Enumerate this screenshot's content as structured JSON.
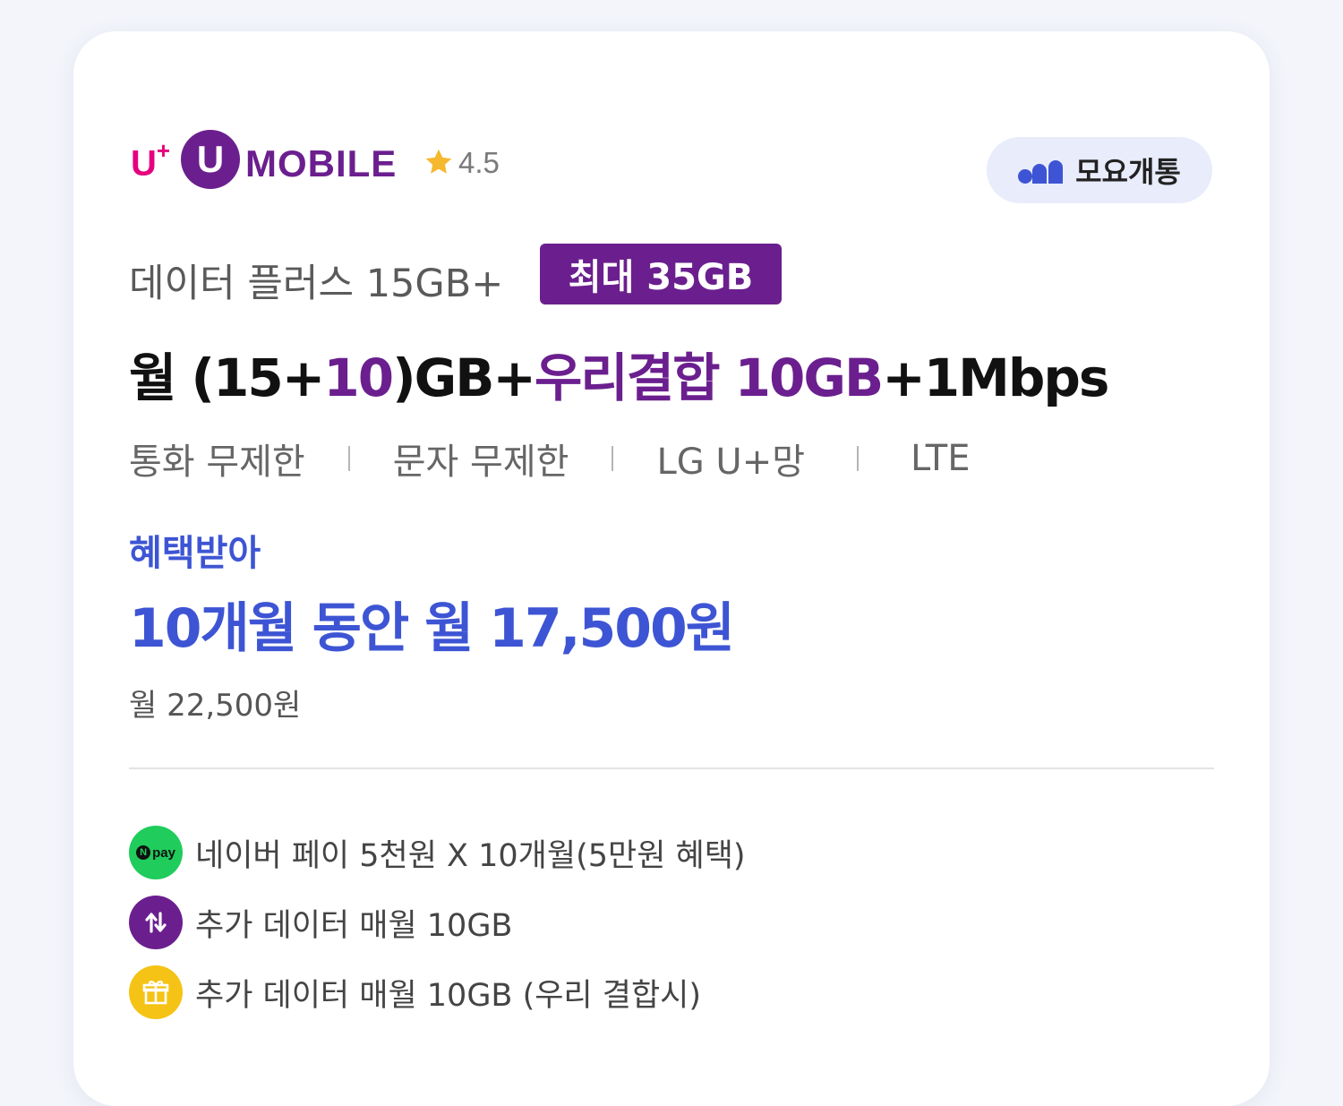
{
  "header": {
    "brand_uplus": "U",
    "brand_plus": "+",
    "brand_circle_letter": "U",
    "brand_mobile": "MOBILE",
    "rating": "4.5",
    "badge_label": "모요개통"
  },
  "plan": {
    "name": "데이터 플러스 15GB+",
    "max_badge": "최대 35GB",
    "headline": {
      "part1": "월 (15+",
      "part2": "10",
      "part3": ")GB+",
      "part4": "우리결합 10GB",
      "part5": "+1Mbps"
    },
    "specs": [
      "통화 무제한",
      "문자 무제한",
      "LG U+망",
      "LTE"
    ]
  },
  "price": {
    "benefit_label": "혜택받아",
    "promo": "10개월 동안 월 17,500원",
    "regular": "월 22,500원"
  },
  "benefits": [
    {
      "icon": "npay-icon",
      "npay_label": "pay",
      "npay_n": "N",
      "text": "네이버 페이 5천원 X 10개월(5만원 혜택)"
    },
    {
      "icon": "data-arrows-icon",
      "text": "추가 데이터 매월 10GB"
    },
    {
      "icon": "gift-icon",
      "text": "추가 데이터 매월 10GB (우리 결합시)"
    }
  ],
  "colors": {
    "brand_purple": "#6b1f8e",
    "brand_pink": "#e6007e",
    "accent_blue": "#3d55d4",
    "npay_green": "#1fcc5c",
    "gift_yellow": "#f5c315"
  }
}
